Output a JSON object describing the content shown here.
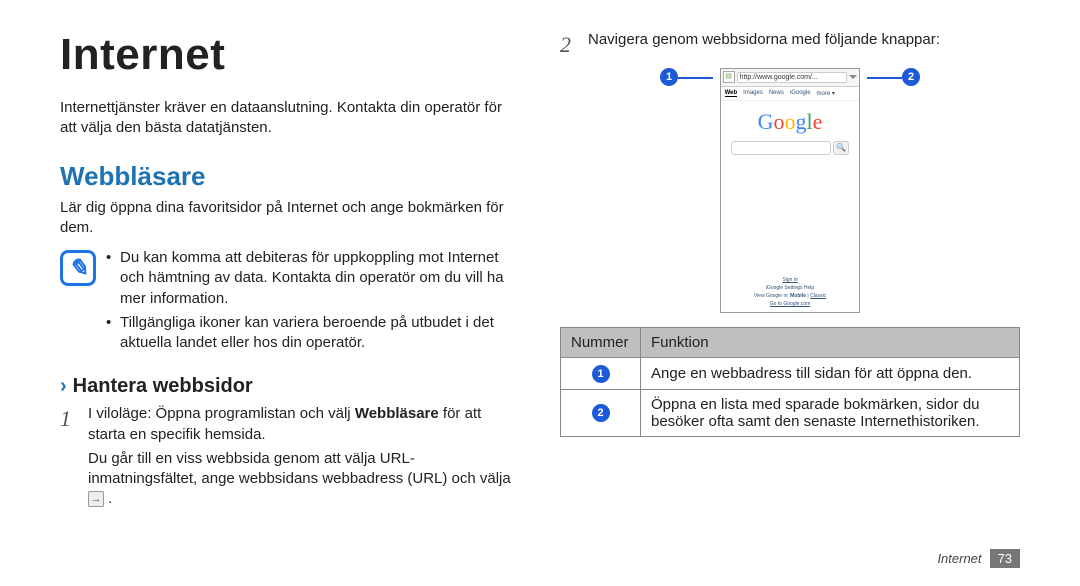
{
  "left": {
    "title": "Internet",
    "intro": "Internettjänster kräver en dataanslutning. Kontakta din operatör för att välja den bästa datatjänsten.",
    "section_heading": "Webbläsare",
    "section_desc": "Lär dig öppna dina favoritsidor på Internet och ange bokmärken för dem.",
    "note_bullets": [
      "Du kan komma att debiteras för uppkoppling mot Internet och hämtning av data. Kontakta din operatör om du vill ha mer information.",
      "Tillgängliga ikoner kan variera beroende på utbudet i det aktuella landet eller hos din operatör."
    ],
    "sub_heading": "Hantera webbsidor",
    "step1_num": "1",
    "step1_pre": "I viloläge: Öppna programlistan och välj ",
    "step1_bold": "Webbläsare",
    "step1_post": " för att starta en specifik hemsida.",
    "step1_para2": "Du går till en viss webbsida genom att välja URL-inmatningsfältet, ange webbsidans webbadress (URL) och välja ",
    "step1_goicon": "→"
  },
  "right": {
    "step2_num": "2",
    "step2_text": "Navigera genom webbsidorna med följande knappar:",
    "callout1": "1",
    "callout2": "2",
    "mock": {
      "url": "http://www.google.com/...",
      "tabs": [
        "Web",
        "Images",
        "News",
        "iGoogle",
        "more ▾"
      ],
      "footer": {
        "signin": "Sign in",
        "links": "iGoogle   Settings   Help",
        "viewline_pre": "View Google in: ",
        "viewline_bold": "Mobile",
        "viewline_sep": " | ",
        "viewline_classic": "Classic",
        "gocom": "Go to Google.com"
      }
    },
    "table": {
      "h1": "Nummer",
      "h2": "Funktion",
      "rows": [
        {
          "num": "1",
          "desc": "Ange en webbadress till sidan för att öppna den."
        },
        {
          "num": "2",
          "desc": "Öppna en lista med sparade bokmärken, sidor du besöker ofta samt den senaste Internethistoriken."
        }
      ]
    }
  },
  "footer": {
    "label": "Internet",
    "page": "73"
  }
}
